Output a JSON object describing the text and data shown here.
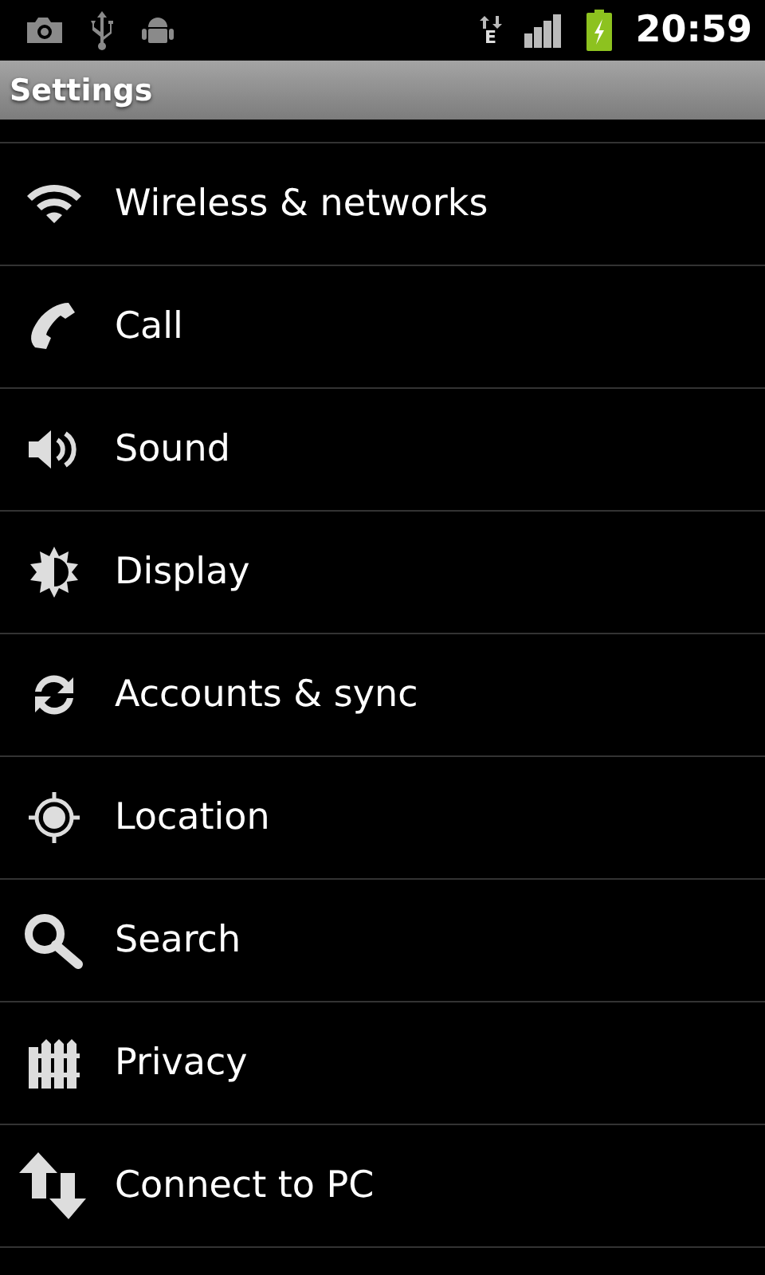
{
  "status_bar": {
    "network_type": "E",
    "time": "20:59"
  },
  "title_bar": {
    "title": "Settings"
  },
  "items": [
    {
      "label": "Wireless & networks",
      "kind": "wifi"
    },
    {
      "label": "Call",
      "kind": "phone"
    },
    {
      "label": "Sound",
      "kind": "speaker"
    },
    {
      "label": "Display",
      "kind": "brightness"
    },
    {
      "label": "Accounts & sync",
      "kind": "sync"
    },
    {
      "label": "Location",
      "kind": "location"
    },
    {
      "label": "Search",
      "kind": "search"
    },
    {
      "label": "Privacy",
      "kind": "fence"
    },
    {
      "label": "Connect to PC",
      "kind": "transfer"
    }
  ]
}
